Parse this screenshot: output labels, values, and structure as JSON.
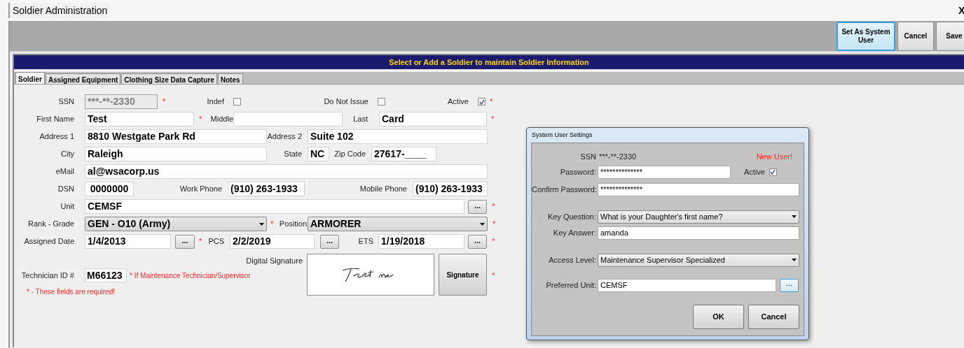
{
  "window": {
    "title": "Soldier Administration",
    "close": "X"
  },
  "toolbar": {
    "buttons": [
      {
        "label": "Set As System User",
        "highlighted": true
      },
      {
        "label": "Cancel",
        "highlighted": false
      },
      {
        "label": "Save",
        "highlighted": false
      }
    ]
  },
  "banner": "Select or Add a Soldier to maintain Soldier Information",
  "tabs": [
    {
      "label": "Soldier",
      "selected": true
    },
    {
      "label": "Assigned Equipment",
      "selected": false
    },
    {
      "label": "Clothing Size Data Capture",
      "selected": false
    },
    {
      "label": "Notes",
      "selected": false
    }
  ],
  "form": {
    "rows": [
      {
        "items": [
          {
            "kind": "label",
            "text": "SSN"
          },
          {
            "kind": "input",
            "value": "***-**-2330",
            "disabled": true
          },
          {
            "kind": "required",
            "text": "*"
          },
          {
            "kind": "label",
            "text": "Indef"
          },
          {
            "kind": "checkbox",
            "checked": false
          },
          {
            "kind": "label",
            "text": "Do Not Issue"
          },
          {
            "kind": "checkbox",
            "checked": false
          },
          {
            "kind": "label",
            "text": "Active"
          },
          {
            "kind": "checkbox",
            "checked": true
          },
          {
            "kind": "required",
            "text": "*"
          }
        ]
      },
      {
        "items": [
          {
            "kind": "label",
            "text": "First Name"
          },
          {
            "kind": "input",
            "value": "Test",
            "disabled": false
          },
          {
            "kind": "required",
            "text": "*"
          },
          {
            "kind": "label",
            "text": "Middle"
          },
          {
            "kind": "input",
            "value": "",
            "disabled": false
          },
          {
            "kind": "label",
            "text": "Last"
          },
          {
            "kind": "input",
            "value": "Card",
            "disabled": false
          },
          {
            "kind": "required",
            "text": "*"
          }
        ]
      },
      {
        "items": [
          {
            "kind": "label",
            "text": "Address 1"
          },
          {
            "kind": "input",
            "value": "8810 Westgate Park Rd",
            "disabled": false
          },
          {
            "kind": "label",
            "text": "Address 2"
          },
          {
            "kind": "input",
            "value": "Suite 102",
            "disabled": false
          }
        ]
      },
      {
        "items": [
          {
            "kind": "label",
            "text": "City"
          },
          {
            "kind": "input",
            "value": "Raleigh",
            "disabled": false
          },
          {
            "kind": "label",
            "text": "State"
          },
          {
            "kind": "input",
            "value": "NC",
            "disabled": false
          },
          {
            "kind": "label",
            "text": "Zip Code"
          },
          {
            "kind": "input",
            "value": "27617-____",
            "disabled": false
          }
        ]
      },
      {
        "items": [
          {
            "kind": "label",
            "text": "eMail"
          },
          {
            "kind": "input",
            "value": "al@wsacorp.us",
            "disabled": false
          }
        ]
      },
      {
        "items": [
          {
            "kind": "label",
            "text": "DSN"
          },
          {
            "kind": "input",
            "value": "0000000",
            "disabled": false
          },
          {
            "kind": "label",
            "text": "Work Phone"
          },
          {
            "kind": "input",
            "value": "(910) 263-1933",
            "disabled": false
          },
          {
            "kind": "label",
            "text": "Mobile Phone"
          },
          {
            "kind": "input",
            "value": "(910) 263-1933",
            "disabled": false
          }
        ]
      },
      {
        "items": [
          {
            "kind": "label",
            "text": "Unit"
          },
          {
            "kind": "input",
            "value": "CEMSF",
            "disabled": false
          },
          {
            "kind": "browse",
            "text": "..."
          },
          {
            "kind": "required",
            "text": "*"
          }
        ]
      },
      {
        "items": [
          {
            "kind": "label",
            "text": "Rank - Grade"
          },
          {
            "kind": "select",
            "value": "GEN - O10 (Army)"
          },
          {
            "kind": "required",
            "text": "*"
          },
          {
            "kind": "label",
            "text": "Position"
          },
          {
            "kind": "select",
            "value": "ARMORER"
          },
          {
            "kind": "required",
            "text": "*"
          }
        ]
      },
      {
        "items": [
          {
            "kind": "label",
            "text": "Assigned Date"
          },
          {
            "kind": "input",
            "value": "1/4/2013",
            "disabled": false
          },
          {
            "kind": "browse",
            "text": "..."
          },
          {
            "kind": "required",
            "text": "*"
          },
          {
            "kind": "label",
            "text": "PCS"
          },
          {
            "kind": "input",
            "value": "2/2/2019",
            "disabled": false
          },
          {
            "kind": "browse",
            "text": "..."
          },
          {
            "kind": "label",
            "text": "ETS"
          },
          {
            "kind": "input",
            "value": "1/19/2018",
            "disabled": false
          },
          {
            "kind": "browse",
            "text": "..."
          },
          {
            "kind": "required",
            "text": "*"
          }
        ]
      }
    ],
    "technician": {
      "label": "Technician ID #",
      "value": "M66123",
      "note": "* If Maintenance Technician/Supervisor"
    },
    "required_note": "* - These fields are required!",
    "signature": {
      "label": "Digital Signature",
      "button": "Signature",
      "required": "*"
    }
  },
  "dialog": {
    "title": "System User Settings",
    "rows": [
      {
        "items": [
          {
            "kind": "label",
            "text": "SSN"
          },
          {
            "kind": "text",
            "text": "***-**-2330"
          },
          {
            "kind": "status",
            "text": "New User!"
          }
        ]
      },
      {
        "items": [
          {
            "kind": "label",
            "text": "Password:"
          },
          {
            "kind": "input",
            "value": "**************"
          },
          {
            "kind": "sidelabel",
            "text": "Active"
          },
          {
            "kind": "checkbox",
            "checked": true
          }
        ]
      },
      {
        "items": [
          {
            "kind": "label",
            "text": "Confirm Password:"
          },
          {
            "kind": "input",
            "value": "**************"
          }
        ]
      },
      {
        "items": [
          {
            "kind": "label",
            "text": "Key Question:"
          },
          {
            "kind": "select",
            "value": "What is your Daughter's first name?"
          }
        ]
      },
      {
        "items": [
          {
            "kind": "label",
            "text": "Key Answer:"
          },
          {
            "kind": "input",
            "value": "amanda"
          }
        ]
      },
      {
        "items": [
          {
            "kind": "label",
            "text": "Access Level:"
          },
          {
            "kind": "select",
            "value": "Maintenance Supervisor Specialized"
          }
        ]
      },
      {
        "items": [
          {
            "kind": "label",
            "text": "Preferred Unit:"
          },
          {
            "kind": "input",
            "value": "CEMSF"
          },
          {
            "kind": "browse",
            "text": "..."
          }
        ]
      }
    ],
    "buttons": [
      "OK",
      "Cancel"
    ]
  }
}
